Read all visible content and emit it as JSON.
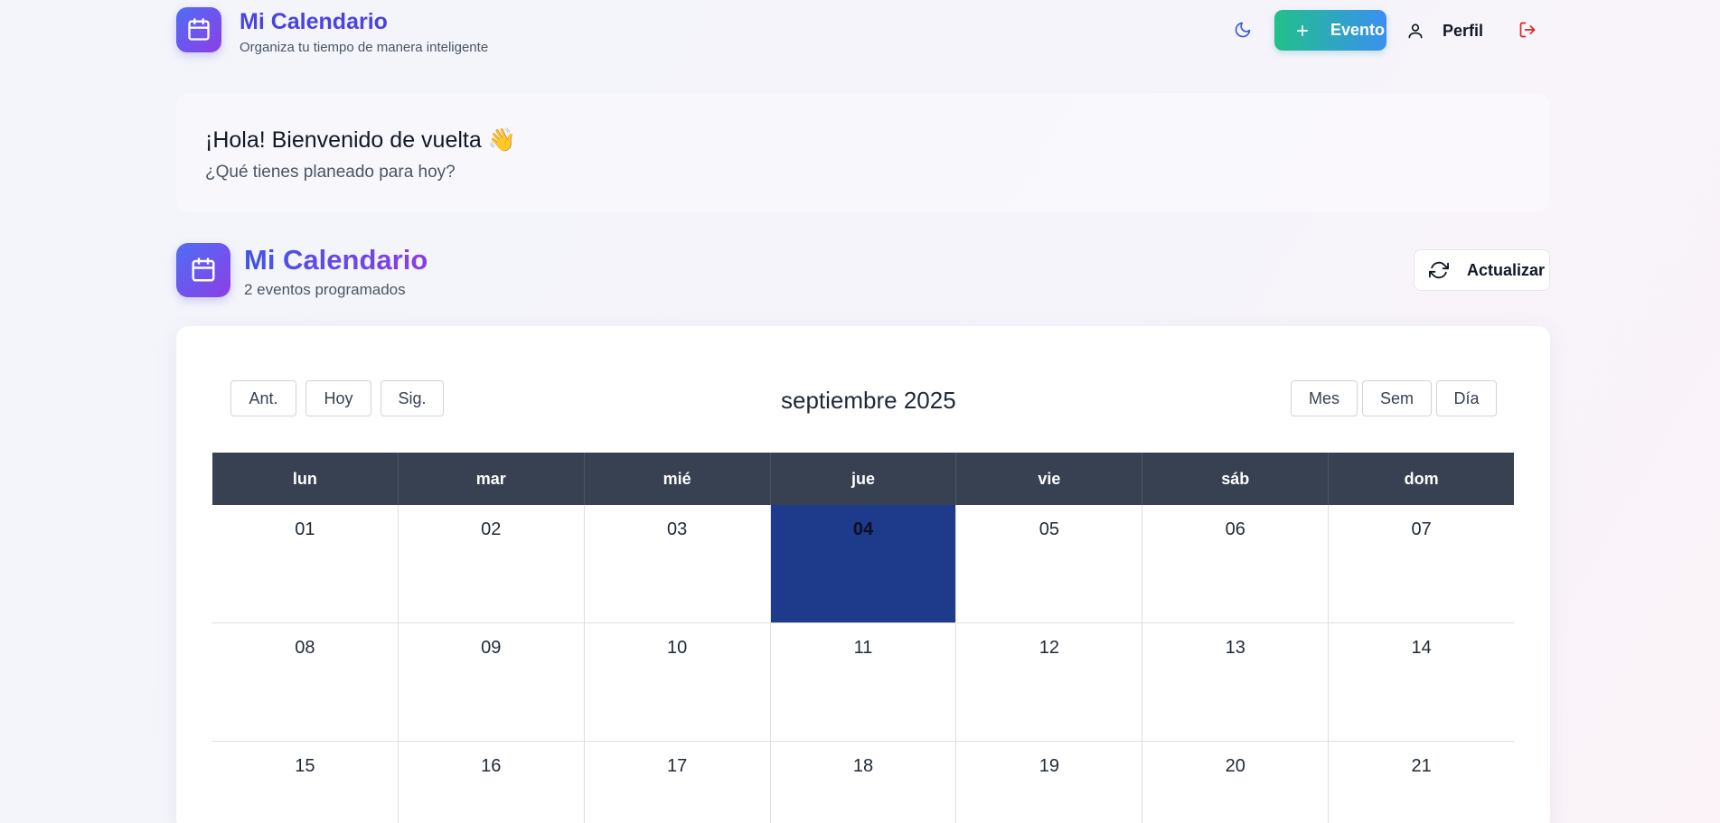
{
  "header": {
    "app_title": "Mi Calendario",
    "app_subtitle": "Organiza tu tiempo de manera inteligente",
    "new_event_label": "Evento",
    "profile_label": "Perfil"
  },
  "welcome": {
    "title": "¡Hola! Bienvenido de vuelta 👋",
    "subtitle": "¿Qué tienes planeado para hoy?"
  },
  "section": {
    "title": "Mi Calendario",
    "subtitle": "2 eventos programados",
    "refresh_label": "Actualizar"
  },
  "calendar": {
    "nav": {
      "prev": "Ant.",
      "today": "Hoy",
      "next": "Sig."
    },
    "month_title": "septiembre 2025",
    "views": {
      "month": "Mes",
      "week": "Sem",
      "day": "Día"
    },
    "weekdays": [
      "lun",
      "mar",
      "mié",
      "jue",
      "vie",
      "sáb",
      "dom"
    ],
    "weeks": [
      [
        "01",
        "02",
        "03",
        "04",
        "05",
        "06",
        "07"
      ],
      [
        "08",
        "09",
        "10",
        "11",
        "12",
        "13",
        "14"
      ],
      [
        "15",
        "16",
        "17",
        "18",
        "19",
        "20",
        "21"
      ]
    ],
    "today": "04"
  },
  "colors": {
    "brand_gradient_start": "#4f6df5",
    "brand_gradient_end": "#8b3fe6",
    "new_event_start": "#22c08a",
    "new_event_end": "#3b8ff0",
    "header_row": "#374151",
    "today_cell": "#1e3a8a",
    "logout": "#dc2626"
  }
}
